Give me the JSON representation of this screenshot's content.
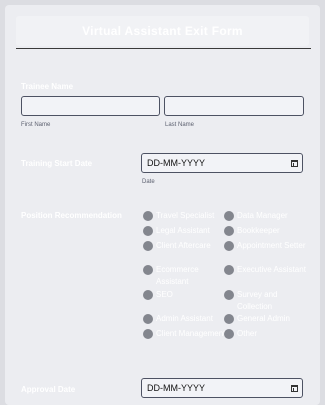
{
  "form": {
    "title": "Virtual Assistant Exit Form"
  },
  "trainee": {
    "label": "Trainee Name",
    "first_value": "",
    "last_value": "",
    "first_sublabel": "First Name",
    "last_sublabel": "Last Name"
  },
  "training_start": {
    "label": "Training Start Date",
    "placeholder": "DD-MM-YYYY",
    "sublabel": "Date"
  },
  "recommendation": {
    "label": "Position Recommendation",
    "options": [
      "Travel Specialist",
      "Data Manager",
      "Legal Assistant",
      "Bookkeeper",
      "Client Aftercare",
      "Appointment Setter",
      "Ecommerce Assistant",
      "Executive Assistant",
      "SEO",
      "Survey and Collection",
      "Admin Assistant",
      "General Admin",
      "Client Management",
      "Other"
    ]
  },
  "approval": {
    "label": "Approval Date",
    "placeholder": "DD-MM-YYYY"
  },
  "colors": {
    "background": "#dcdde2",
    "card": "#ecedf1",
    "input_border": "#4d5263",
    "radio": "#83868e"
  }
}
